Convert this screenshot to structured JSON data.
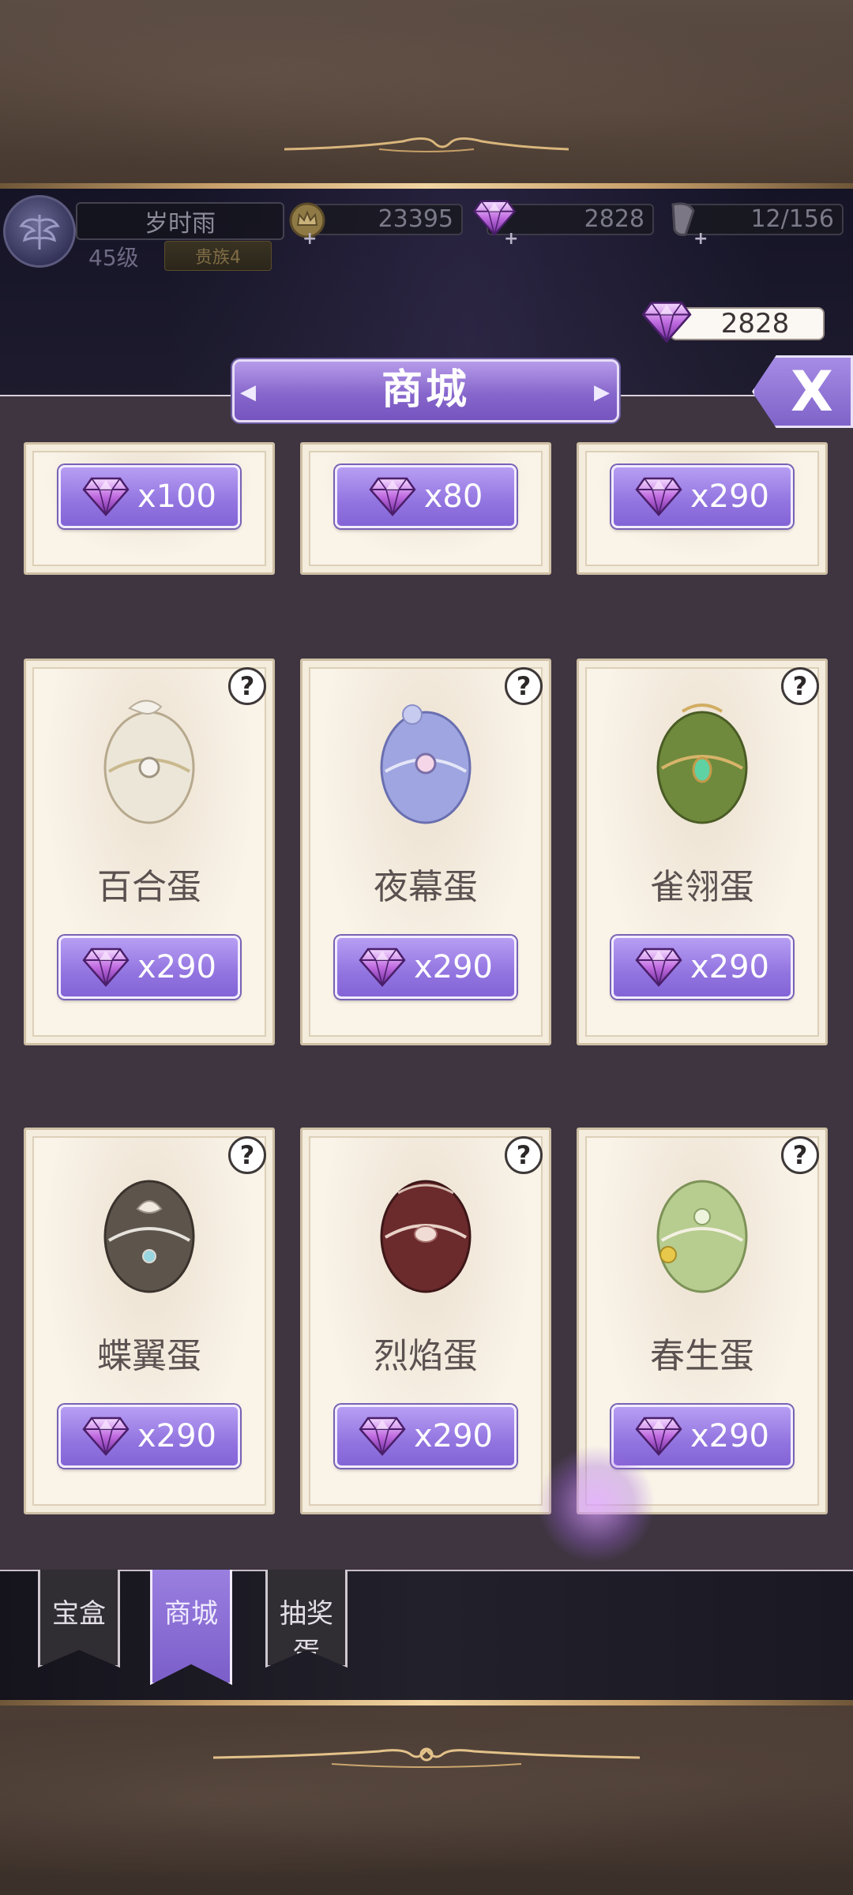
{
  "hud": {
    "player_name": "岁时雨",
    "level": "45级",
    "rank": "贵族4",
    "gold": "23395",
    "gems": "2828",
    "stamina": "12/156",
    "plus_glyph": "+"
  },
  "gem_balance": "2828",
  "shop": {
    "title": "商城",
    "close_glyph": "X",
    "help_glyph": "?",
    "top_row_prices": [
      "x100",
      "x80",
      "x290"
    ],
    "items": [
      {
        "name": "百合蛋",
        "price": "x290",
        "color": "#e7e1d3"
      },
      {
        "name": "夜幕蛋",
        "price": "x290",
        "color": "#9aa0db"
      },
      {
        "name": "雀翎蛋",
        "price": "x290",
        "color": "#6f8a3c"
      },
      {
        "name": "蝶翼蛋",
        "price": "x290",
        "color": "#5d544c"
      },
      {
        "name": "烈焰蛋",
        "price": "x290",
        "color": "#6b2a2c"
      },
      {
        "name": "春生蛋",
        "price": "x290",
        "color": "#b7cc8f"
      }
    ]
  },
  "tabs": [
    {
      "label": "宝盒",
      "active": false
    },
    {
      "label": "商城",
      "active": true
    },
    {
      "label": "抽奖蛋",
      "active": false
    }
  ],
  "icons": [
    "crown-coin-icon",
    "gem-icon",
    "stamina-icon",
    "close-icon",
    "help-icon",
    "egg-icon",
    "wing-emblem-icon"
  ],
  "colors": {
    "accent": "#8b6bd6",
    "card": "#f9f3e8",
    "gold_line": "#c9a06b"
  }
}
